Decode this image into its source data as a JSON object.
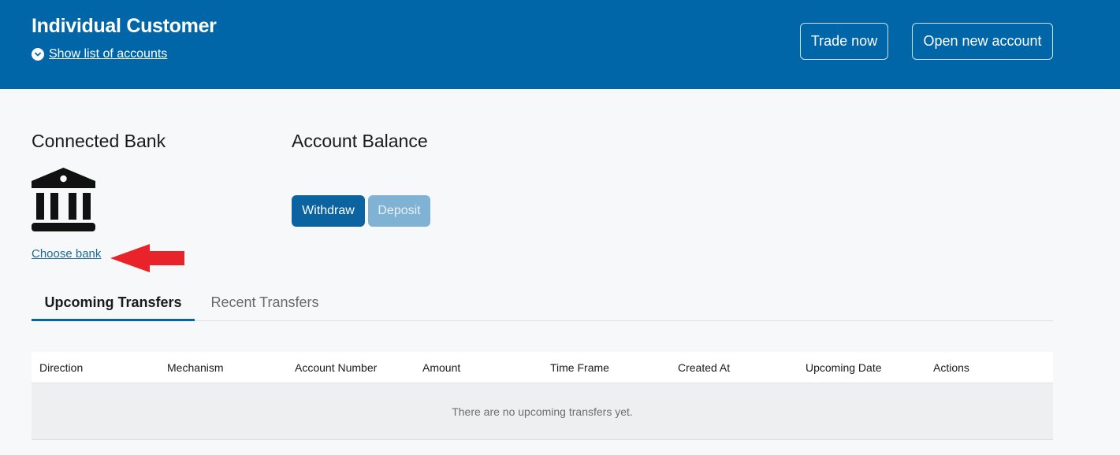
{
  "header": {
    "title": "Individual Customer",
    "show_accounts_label": "Show list of accounts",
    "trade_now_label": "Trade now",
    "open_account_label": "Open new account",
    "background_color": "#0066a8"
  },
  "connected_bank": {
    "title": "Connected Bank",
    "icon": "bank-icon",
    "choose_bank_label": "Choose bank"
  },
  "account_balance": {
    "title": "Account Balance",
    "withdraw_label": "Withdraw",
    "deposit_label": "Deposit"
  },
  "tabs": [
    {
      "label": "Upcoming Transfers",
      "active": true
    },
    {
      "label": "Recent Transfers",
      "active": false
    }
  ],
  "table": {
    "columns": [
      "Direction",
      "Mechanism",
      "Account Number",
      "Amount",
      "Time Frame",
      "Created At",
      "Upcoming Date",
      "Actions"
    ],
    "empty_message": "There are no upcoming transfers yet."
  },
  "annotation": {
    "icon": "red-arrow-icon",
    "color": "#e8242a"
  }
}
